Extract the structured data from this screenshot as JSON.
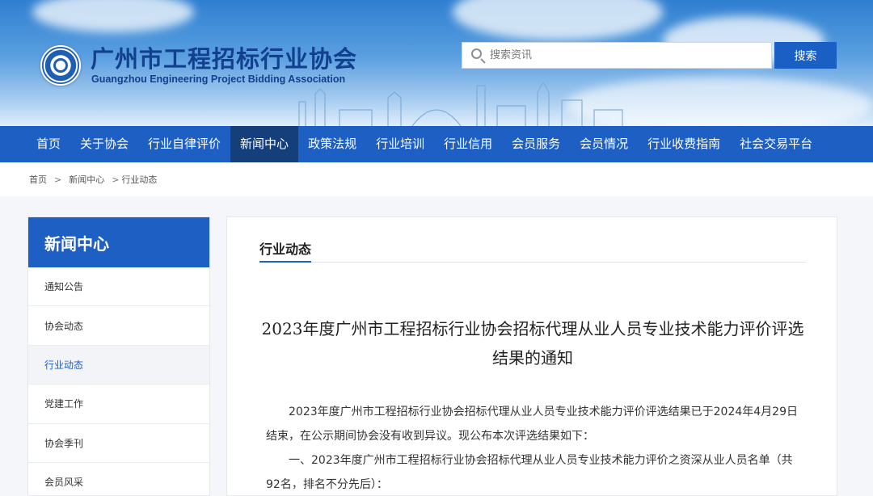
{
  "header": {
    "title": "广州市工程招标行业协会",
    "subtitle": "Guangzhou Engineering Project Bidding Association",
    "search": {
      "placeholder": "搜索资讯",
      "button_label": "搜索"
    }
  },
  "nav": {
    "items": [
      "首页",
      "关于协会",
      "行业自律评价",
      "新闻中心",
      "政策法规",
      "行业培训",
      "行业信用",
      "会员服务",
      "会员情况",
      "行业收费指南",
      "社会交易平台"
    ],
    "active": "新闻中心"
  },
  "breadcrumb": {
    "items": [
      "首页",
      "新闻中心",
      "行业动态"
    ],
    "separator": ">"
  },
  "sidebar": {
    "title": "新闻中心",
    "items": [
      "通知公告",
      "协会动态",
      "行业动态",
      "党建工作",
      "协会季刊",
      "会员风采"
    ],
    "active": "行业动态"
  },
  "main": {
    "section_label": "行业动态",
    "article": {
      "title": "2023年度广州市工程招标行业协会招标代理从业人员专业技术能力评价评选结果的通知",
      "paragraphs": [
        "2023年度广州市工程招标行业协会招标代理从业人员专业技术能力评价评选结果已于2024年4月29日结束，在公示期间协会没有收到异议。现公布本次评选结果如下：",
        "一、2023年度广州市工程招标行业协会招标代理从业人员专业技术能力评价之资深从业人员名单（共92名，排名不分先后）："
      ]
    }
  },
  "colors": {
    "primary": "#1d5fc2",
    "nav_active": "#153f7a",
    "title_blue": "#123f8e"
  }
}
